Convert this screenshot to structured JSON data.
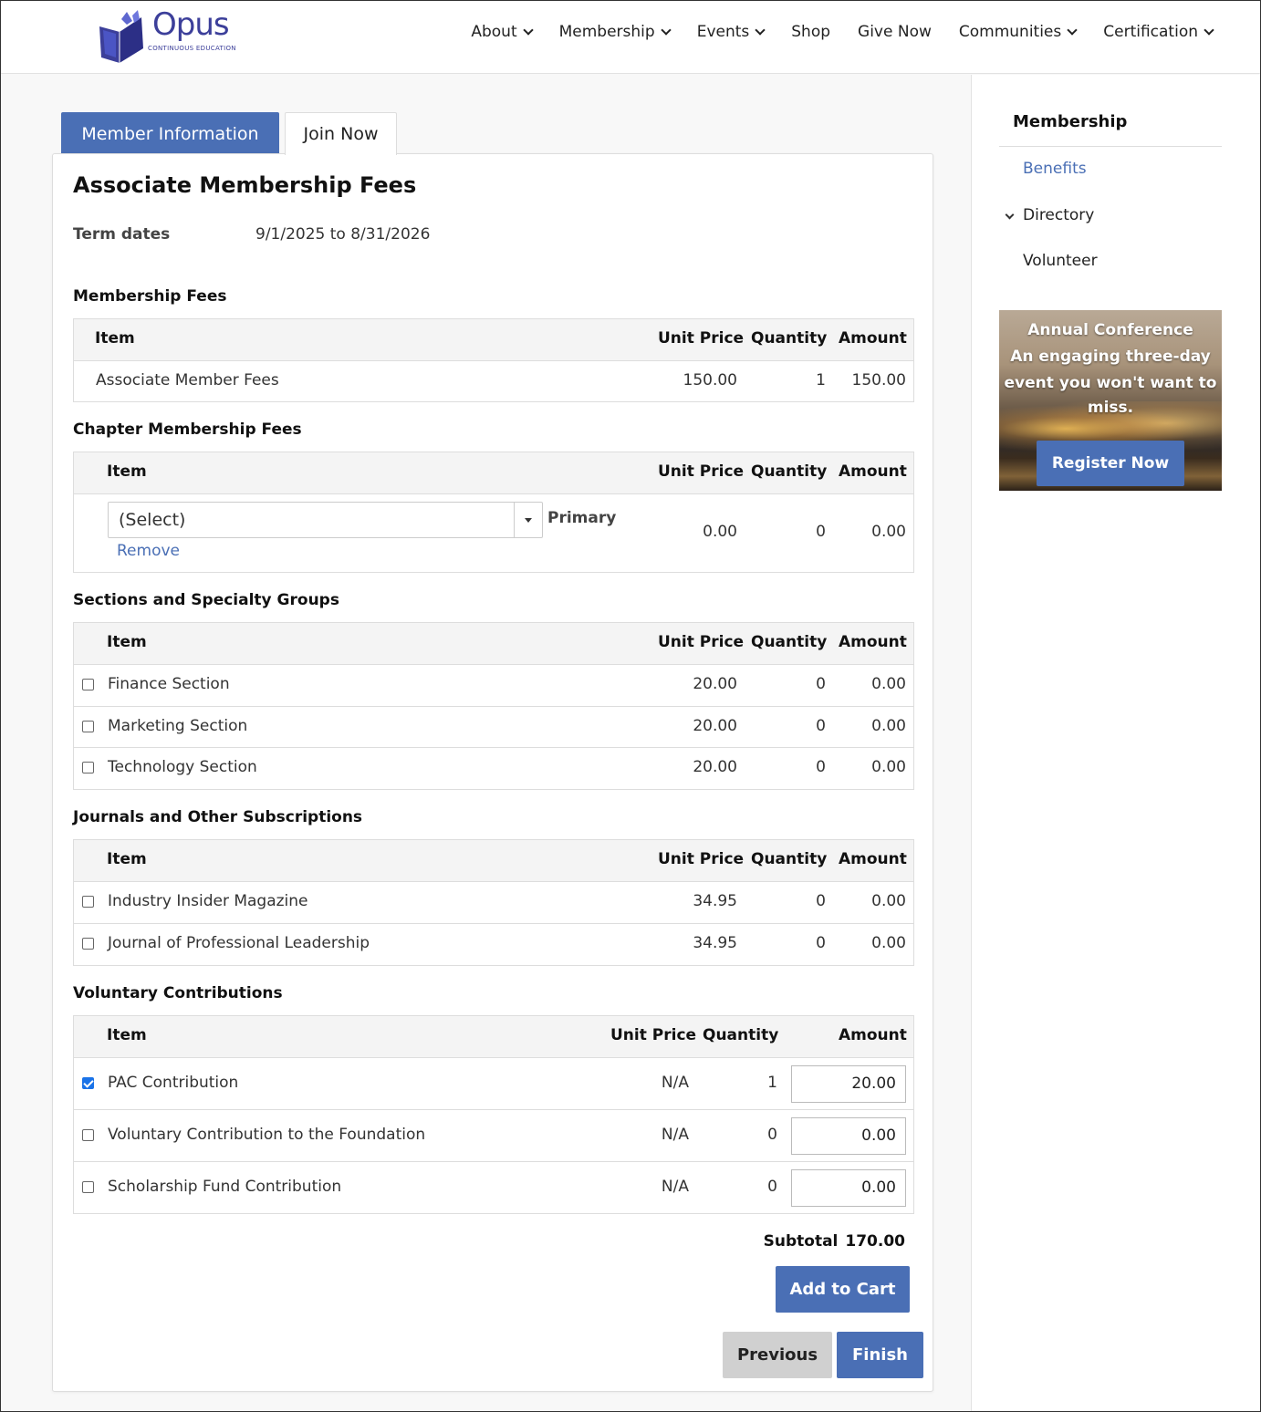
{
  "header": {
    "logo": {
      "word": "Opus",
      "tagline": "CONTINUOUS  EDUCATION"
    },
    "nav": [
      {
        "label": "About",
        "dropdown": true
      },
      {
        "label": "Membership",
        "dropdown": true
      },
      {
        "label": "Events",
        "dropdown": true
      },
      {
        "label": "Shop",
        "dropdown": false
      },
      {
        "label": "Give Now",
        "dropdown": false
      },
      {
        "label": "Communities",
        "dropdown": true
      },
      {
        "label": "Certification",
        "dropdown": true
      }
    ]
  },
  "tabs": {
    "active": "Member Information",
    "inactive": "Join Now"
  },
  "card": {
    "title": "Associate Membership Fees",
    "term_label": "Term dates",
    "term_value": "9/1/2025 to 8/31/2026",
    "columns": {
      "item": "Item",
      "unit_price": "Unit Price",
      "quantity": "Quantity",
      "amount": "Amount"
    },
    "membership_fees": {
      "title": "Membership Fees",
      "rows": [
        {
          "item": "Associate Member Fees",
          "unit_price": "150.00",
          "quantity": "1",
          "amount": "150.00"
        }
      ]
    },
    "chapter_fees": {
      "title": "Chapter Membership Fees",
      "select_value": "(Select)",
      "primary_label": "Primary",
      "remove_label": "Remove",
      "unit_price": "0.00",
      "quantity": "0",
      "amount": "0.00"
    },
    "sections": {
      "title": "Sections and Specialty Groups",
      "rows": [
        {
          "item": "Finance Section",
          "unit_price": "20.00",
          "quantity": "0",
          "amount": "0.00",
          "checked": false
        },
        {
          "item": "Marketing Section",
          "unit_price": "20.00",
          "quantity": "0",
          "amount": "0.00",
          "checked": false
        },
        {
          "item": "Technology Section",
          "unit_price": "20.00",
          "quantity": "0",
          "amount": "0.00",
          "checked": false
        }
      ]
    },
    "journals": {
      "title": "Journals and Other Subscriptions",
      "rows": [
        {
          "item": "Industry Insider Magazine",
          "unit_price": "34.95",
          "quantity": "0",
          "amount": "0.00",
          "checked": false
        },
        {
          "item": "Journal of Professional Leadership",
          "unit_price": "34.95",
          "quantity": "0",
          "amount": "0.00",
          "checked": false
        }
      ]
    },
    "contributions": {
      "title": "Voluntary Contributions",
      "rows": [
        {
          "item": "PAC Contribution",
          "unit_price": "N/A",
          "quantity": "1",
          "amount": "20.00",
          "checked": true
        },
        {
          "item": "Voluntary Contribution to the Foundation",
          "unit_price": "N/A",
          "quantity": "0",
          "amount": "0.00",
          "checked": false
        },
        {
          "item": "Scholarship Fund Contribution",
          "unit_price": "N/A",
          "quantity": "0",
          "amount": "0.00",
          "checked": false
        }
      ]
    },
    "subtotal_label": "Subtotal",
    "subtotal_value": "170.00",
    "add_to_cart": "Add to Cart",
    "previous": "Previous",
    "finish": "Finish"
  },
  "sidebar": {
    "title": "Membership",
    "links": [
      {
        "label": "Benefits",
        "active": true
      },
      {
        "label": "Directory",
        "expandable": true
      },
      {
        "label": "Volunteer"
      }
    ],
    "promo": {
      "line1": "Annual Conference",
      "line2": "An engaging three-day",
      "line3": "event you won't want to",
      "line4": "miss.",
      "button": "Register Now"
    }
  },
  "colors": {
    "accent": "#4a6fb5",
    "checkbox_checked": "#1a73e8"
  }
}
